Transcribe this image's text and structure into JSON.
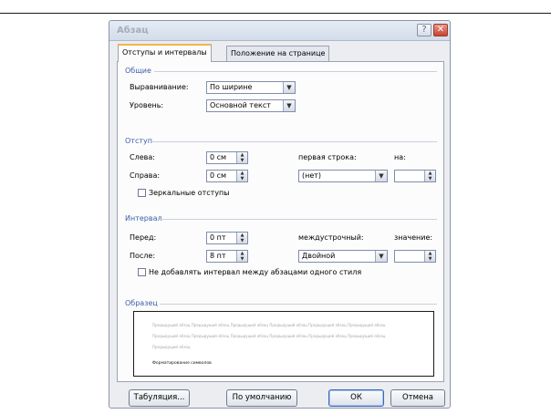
{
  "window": {
    "title": "Абзац",
    "help_icon": "?",
    "close_icon": "✕"
  },
  "tabs": [
    {
      "label": "Отступы и интервалы",
      "active": true
    },
    {
      "label": "Положение на странице",
      "active": false
    }
  ],
  "general": {
    "title": "Общие",
    "alignment_label": "Выравнивание:",
    "alignment_value": "По ширине",
    "level_label": "Уровень:",
    "level_value": "Основной текст"
  },
  "indent": {
    "title": "Отступ",
    "left_label": "Слева:",
    "left_value": "0 см",
    "right_label": "Справа:",
    "right_value": "0 см",
    "first_line_label": "первая строка:",
    "first_line_value": "(нет)",
    "by_label": "на:",
    "by_value": "",
    "mirror_label": "Зеркальные отступы",
    "mirror_checked": false
  },
  "spacing": {
    "title": "Интервал",
    "before_label": "Перед:",
    "before_value": "0 пт",
    "after_label": "После:",
    "after_value": "8 пт",
    "line_label": "междустрочный:",
    "line_value": "Двойной",
    "at_label": "значение:",
    "at_value": "",
    "no_space_label": "Не добавлять интервал между абзацами одного стиля",
    "no_space_checked": false
  },
  "preview": {
    "title": "Образец",
    "sample_text": "Предыдущий абзац Предыдущий абзац Предыдущий абзац Предыдущий абзац Предыдущий абзац Предыдущий абзац",
    "sample_text_2": "Предыдущий абзац Предыдущий абзац Предыдущий абзац Предыдущий абзац Предыдущий абзац Предыдущий абзац",
    "sample_text_3": "Предыдущий абзац",
    "current_text": "Форматирование символов"
  },
  "buttons": {
    "tabs": "Табуляция...",
    "default": "По умолчанию",
    "ok": "ОК",
    "cancel": "Отмена"
  },
  "colors": {
    "accent": "#3c5fa8",
    "close": "#c8402e"
  }
}
